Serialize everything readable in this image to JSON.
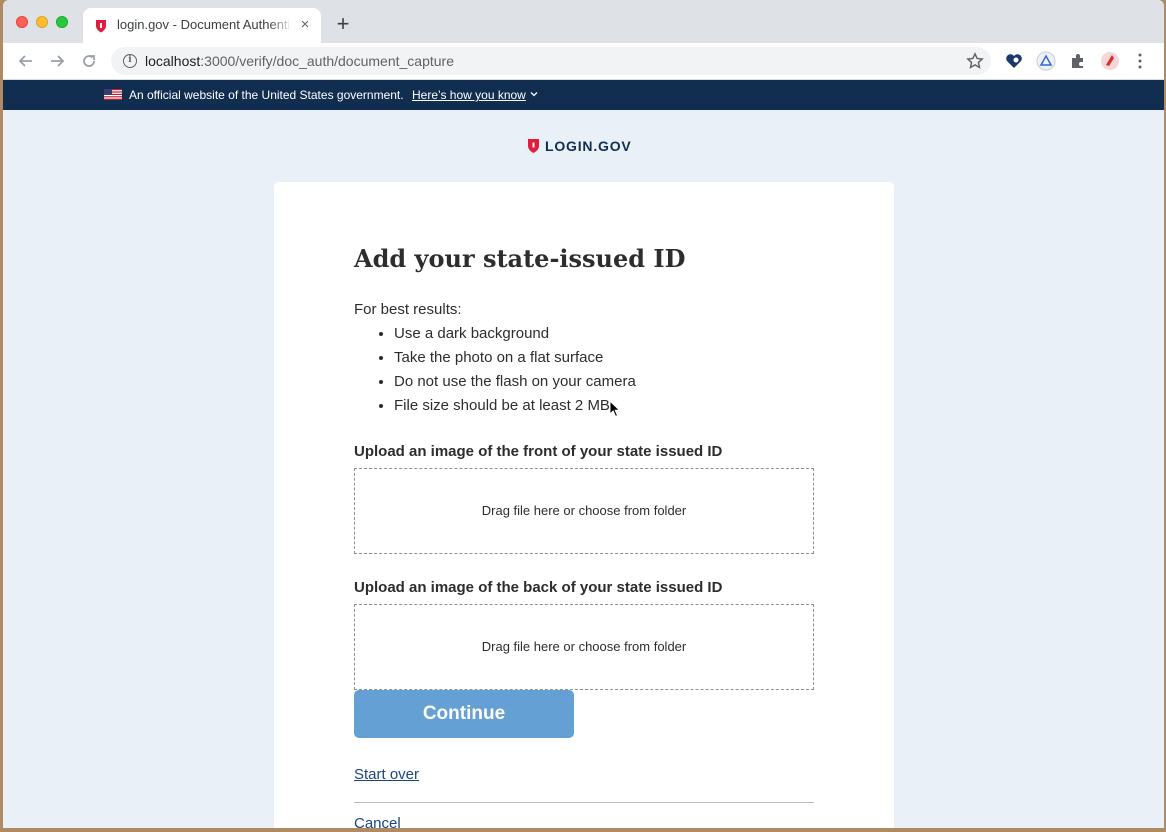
{
  "browser": {
    "tab_title": "login.gov - Document Authentication",
    "tab_close": "×",
    "new_tab": "+",
    "url_host": "localhost",
    "url_path": ":3000/verify/doc_auth/document_capture",
    "icons": [
      "back-arrow-icon",
      "forward-arrow-icon",
      "reload-icon",
      "site-info-icon",
      "star-icon",
      "extension-icon",
      "menu-icon"
    ]
  },
  "gov_banner": {
    "text": "An official website of the United States government.",
    "link": "Here’s how you know"
  },
  "logo": {
    "text": "LOGIN.GOV",
    "color": "#e21c3d"
  },
  "page": {
    "heading": "Add your state-issued ID",
    "intro": "For best results:",
    "tips": [
      "Use a dark background",
      "Take the photo on a flat surface",
      "Do not use the flash on your camera",
      "File size should be at least 2 MB"
    ],
    "front_label": "Upload an image of the front of your state issued ID",
    "front_dropzone": "Drag file here or choose from folder",
    "back_label": "Upload an image of the back of your state issued ID",
    "back_dropzone": "Drag file here or choose from folder",
    "continue": "Continue",
    "start_over": "Start over",
    "cancel": "Cancel"
  },
  "colors": {
    "banner_bg": "#112e51",
    "button_bg": "#64a0d4",
    "link": "#1a4480",
    "page_bg": "#e9f0f8"
  }
}
